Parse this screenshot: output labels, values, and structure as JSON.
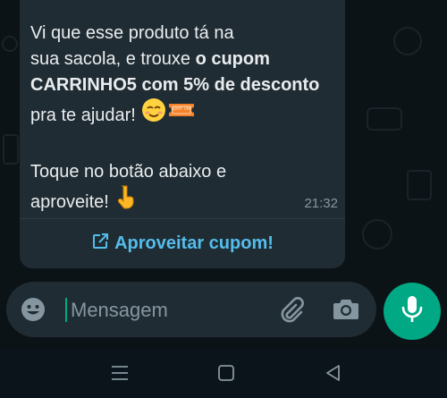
{
  "message": {
    "line1": "Vi que esse produto tá na",
    "line2_start": "sua sacola, e trouxe ",
    "line2_bold": "o cupom",
    "line3_bold": "CARRINHO5 com 5% de desconto",
    "line4": "pra te ajudar!",
    "emoji_smile": "😌",
    "emoji_ticket_text": "ADMIT ONE",
    "line5": "Toque no botão abaixo e",
    "line6": "aproveite!",
    "emoji_point": "👇",
    "time": "21:32"
  },
  "cta": {
    "label": "Aproveitar cupom!",
    "icon": "external-link-icon"
  },
  "composer": {
    "placeholder": "Mensagem",
    "emoji_icon": "emoji-icon",
    "attach_icon": "paperclip-icon",
    "camera_icon": "camera-icon",
    "mic_icon": "microphone-icon"
  },
  "navigation": {
    "recents_icon": "recents-icon",
    "home_icon": "home-icon",
    "back_icon": "back-icon"
  },
  "colors": {
    "background": "#0b141a",
    "bubble": "#202c33",
    "link": "#53bdeb",
    "accent": "#00a884",
    "text": "#e9edef",
    "muted": "#8696a0"
  }
}
